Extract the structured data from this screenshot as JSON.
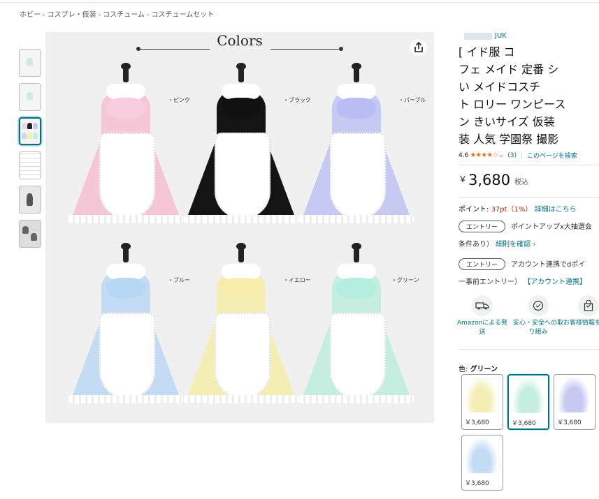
{
  "breadcrumb": [
    "ホビー",
    "コスプレ・仮装",
    "コスチューム",
    "コスチュームセット"
  ],
  "breadcrumb_sep": "›",
  "thumbnails": [
    {
      "name": "thumb-1",
      "color": "#cfe8e4"
    },
    {
      "name": "thumb-2",
      "color": "#cfe8e4"
    },
    {
      "name": "thumb-3",
      "color": "#f5d4e3",
      "selected": true
    },
    {
      "name": "thumb-4",
      "color": "#dcdcdc"
    },
    {
      "name": "thumb-5",
      "color": "#888888"
    },
    {
      "name": "thumb-6",
      "color": "#777777"
    }
  ],
  "main_image": {
    "title": "Colors",
    "dresses": [
      {
        "label": "・ピンク",
        "color": "#f4c6d6",
        "bow": "#f7cde0"
      },
      {
        "label": "・ブラック",
        "color": "#141414",
        "bow": "#111111"
      },
      {
        "label": "・パープル",
        "color": "#c6c9f2",
        "bow": "#b9bdf4"
      },
      {
        "label": "・ブルー",
        "color": "#c3dcf3",
        "bow": "#b7d8f5"
      },
      {
        "label": "・イエロー",
        "color": "#f5eeb4",
        "bow": "#f6eeaa"
      },
      {
        "label": "・グリーン",
        "color": "#c3eee0",
        "bow": "#b5eedc"
      }
    ]
  },
  "product": {
    "brand_suffix": "JUK",
    "title_lines": [
      "[ イド服 コ",
      "フェ メイド 定番 シ",
      "い メイドコスチ",
      "ト ロリー ワンピース",
      "ン きいサイズ 仮装",
      "装 人気 学園祭 撮影"
    ],
    "rating_value": "4.6",
    "stars": "★★★★☆",
    "rating_count": "(3)",
    "rating_sep": "|",
    "search_page_link": "このページを検索",
    "price_symbol": "￥",
    "price": "3,680",
    "tax": "税込",
    "points_label": "ポイント: ",
    "points_value": "37pt（1%）",
    "points_link": "詳細はこちら",
    "promos": [
      {
        "pill": "エントリー",
        "text": "ポイントアップx大抽選会",
        "line2": "条件あり）",
        "line2_link": "細則を確認 ›"
      },
      {
        "pill": "エントリー",
        "text": "アカウント連携でdポイ",
        "line2": "一事前エントリー）",
        "line2_link": "【アカウント連携】"
      }
    ],
    "features": [
      {
        "label": "Amazonによる発送",
        "icon": "truck-icon"
      },
      {
        "label": "安心・安全への取り組み",
        "icon": "shield-icon"
      },
      {
        "label": "お客様情報を保護",
        "icon": "lock-box-icon"
      }
    ],
    "color_label_prefix": "色: ",
    "color_selected": "グリーン",
    "swatches": [
      {
        "price": "￥3,680",
        "color": "#f5eeb4"
      },
      {
        "price": "￥3,680",
        "color": "#c3eee0",
        "selected": true
      },
      {
        "price": "￥3,680",
        "color": "#c6c9f2"
      },
      {
        "price": "￥3,680",
        "color": "#c3dcf3"
      }
    ]
  }
}
